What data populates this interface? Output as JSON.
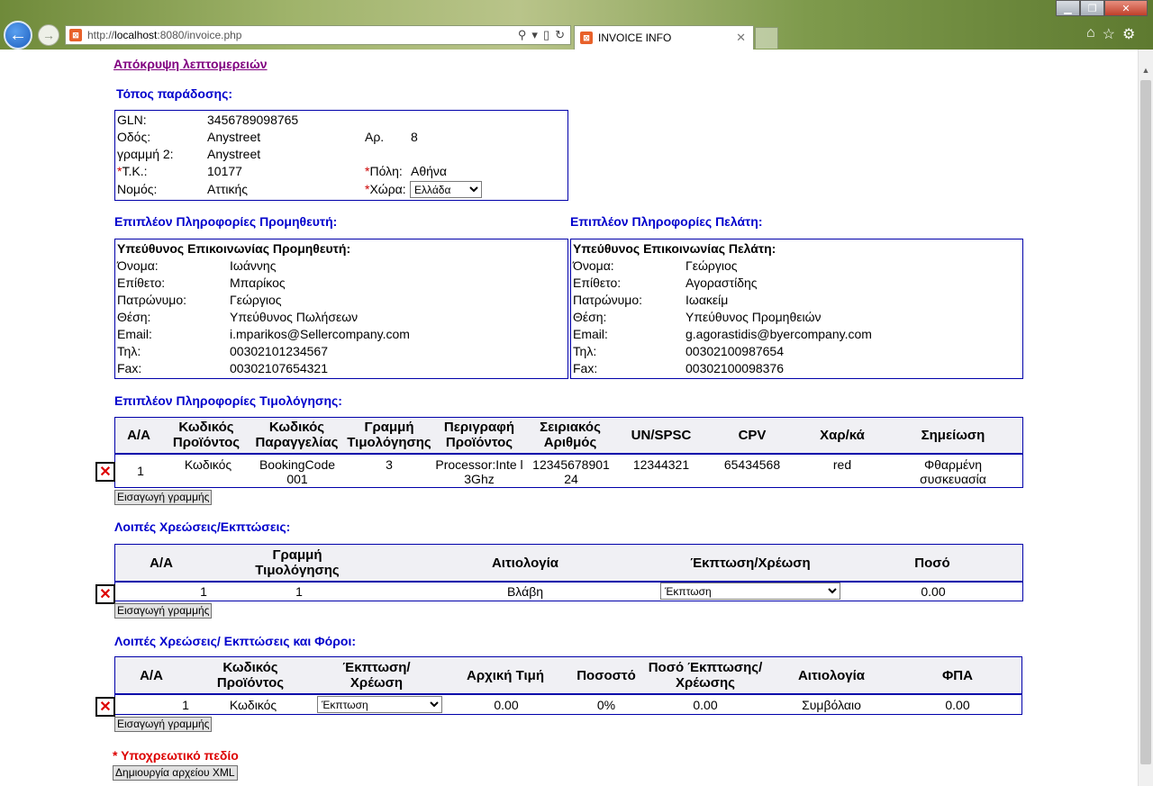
{
  "browser": {
    "url_prefix": "http://",
    "url_host": "localhost",
    "url_rest": ":8080/invoice.php",
    "tab_title": "INVOICE INFO"
  },
  "page": {
    "hide_details_link": "Απόκρυψη λεπτομερειών",
    "delivery": {
      "title": "Τόπος παράδοσης:",
      "gln_label": "GLN:",
      "gln_value": "3456789098765",
      "street_label": "Οδός:",
      "street_value": "Anystreet",
      "number_label": "Αρ.",
      "number_value": "8",
      "line2_label": "γραμμή 2:",
      "line2_value": "Anystreet",
      "zip_label": "Τ.Κ.:",
      "zip_value": "10177",
      "city_label": "Πόλη:",
      "city_value": "Αθήνα",
      "region_label": "Νομός:",
      "region_value": "Αττικής",
      "country_label": "Χώρα:",
      "country_value": "Ελλάδα",
      "required_mark": "*"
    },
    "supplier": {
      "title": "Επιπλέον Πληροφορίες Προμηθευτή:",
      "heading": "Υπεύθυνος Επικοινωνίας Προμηθευτή:",
      "rows": [
        {
          "label": "Όνομα:",
          "value": "Ιωάννης"
        },
        {
          "label": "Επίθετο:",
          "value": "Μπαρίκος"
        },
        {
          "label": "Πατρώνυμο:",
          "value": "Γεώργιος"
        },
        {
          "label": "Θέση:",
          "value": "Υπεύθυνος Πωλήσεων"
        },
        {
          "label": "Email:",
          "value": "i.mparikos@Sellercompany.com"
        },
        {
          "label": "Τηλ:",
          "value": "00302101234567"
        },
        {
          "label": "Fax:",
          "value": "00302107654321"
        }
      ]
    },
    "customer": {
      "title": "Επιπλέον Πληροφορίες Πελάτη:",
      "heading": "Υπεύθυνος Επικοινωνίας Πελάτη:",
      "rows": [
        {
          "label": "Όνομα:",
          "value": "Γεώργιος"
        },
        {
          "label": "Επίθετο:",
          "value": "Αγοραστίδης"
        },
        {
          "label": "Πατρώνυμο:",
          "value": "Ιωακείμ"
        },
        {
          "label": "Θέση:",
          "value": "Υπεύθυνος Προμηθειών"
        },
        {
          "label": "Email:",
          "value": "g.agorastidis@byercompany.com"
        },
        {
          "label": "Τηλ:",
          "value": "00302100987654"
        },
        {
          "label": "Fax:",
          "value": "00302100098376"
        }
      ]
    },
    "invoicing": {
      "title": "Επιπλέον Πληροφορίες Τιμολόγησης:",
      "headers": [
        "Α/Α",
        "Κωδικός Προϊόντος",
        "Κωδικός Παραγγελίας",
        "Γραμμή Τιμολόγησης",
        "Περιγραφή Προϊόντος",
        "Σειριακός Αριθμός",
        "UN/SPSC",
        "CPV",
        "Χαρ/κά",
        "Σημείωση"
      ],
      "row": [
        "1",
        "Κωδικός",
        "BookingCode 001",
        "3",
        "Processor:Inte l 3Ghz",
        "12345678901 24",
        "12344321",
        "65434568",
        "red",
        "Φθαρμένη συσκευασία"
      ],
      "add_button": "Εισαγωγή γραμμής"
    },
    "charges": {
      "title": "Λοιπές Χρεώσεις/Εκπτώσεις:",
      "headers": [
        "Α/Α",
        "Γραμμή Τιμολόγησης",
        "Αιτιολογία",
        "Έκπτωση/Χρέωση",
        "Ποσό"
      ],
      "row": {
        "aa": "1",
        "line": "1",
        "reason": "Βλάβη",
        "type": "Έκπτωση",
        "amount": "0.00"
      },
      "add_button": "Εισαγωγή γραμμής"
    },
    "charges_taxes": {
      "title": "Λοιπές Χρεώσεις/ Εκπτώσεις και Φόροι:",
      "headers": [
        "Α/Α",
        "Κωδικός Προϊόντος",
        "Έκπτωση/ Χρέωση",
        "Αρχική Τιμή",
        "Ποσοστό",
        "Ποσό Έκπτωσης/ Χρέωσης",
        "Αιτιολογία",
        "ΦΠΑ"
      ],
      "row": {
        "aa": "1",
        "code": "Κωδικός",
        "type": "Έκπτωση",
        "initial": "0.00",
        "percent": "0%",
        "amount": "0.00",
        "reason": "Συμβόλαιο",
        "vat": "0.00"
      },
      "add_button": "Εισαγωγή γραμμής"
    },
    "required_note": "* Υποχρεωτικό πεδίο",
    "xml_button": "Δημιουργία αρχείου XML"
  }
}
